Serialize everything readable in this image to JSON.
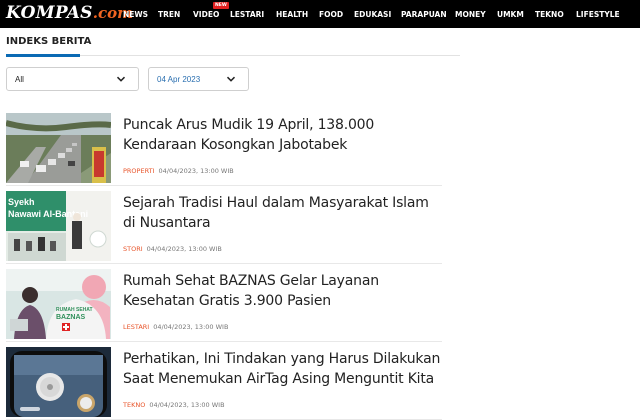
{
  "brand": {
    "name": "KOMPAS",
    "suffix": ".com"
  },
  "nav": {
    "items": [
      {
        "label": "NEWS"
      },
      {
        "label": "TREN"
      },
      {
        "label": "VIDEO",
        "badge": "NEW"
      },
      {
        "label": "LESTARI"
      },
      {
        "label": "HEALTH"
      },
      {
        "label": "FOOD"
      },
      {
        "label": "EDUKASI"
      },
      {
        "label": "PARAPUAN"
      },
      {
        "label": "MONEY"
      },
      {
        "label": "UMKM"
      },
      {
        "label": "TEKNO"
      },
      {
        "label": "LIFESTYLE"
      }
    ]
  },
  "page": {
    "title": "INDEKS BERITA"
  },
  "filters": {
    "category_value": "All",
    "date_value": "04 Apr 2023"
  },
  "articles": [
    {
      "title": "Puncak Arus Mudik 19 April, 138.000 Kendaraan Kosongkan Jabotabek",
      "category": "PROPERTI",
      "date": "04/04/2023, 13:00 WIB",
      "thumb": "highway"
    },
    {
      "title": "Sejarah Tradisi Haul dalam Masyarakat Islam di Nusantara",
      "category": "STORI",
      "date": "04/04/2023, 13:00 WIB",
      "thumb": "event",
      "thumb_text": [
        "Syekh",
        "Nawawi Al-Bantani"
      ]
    },
    {
      "title": "Rumah Sehat BAZNAS Gelar Layanan Kesehatan Gratis 3.900 Pasien",
      "category": "LESTARI",
      "date": "04/04/2023, 13:00 WIB",
      "thumb": "health",
      "thumb_text": [
        "RUMAH SEHAT",
        "BAZNAS"
      ]
    },
    {
      "title": "Perhatikan, Ini Tindakan yang Harus Dilakukan Saat Menemukan AirTag Asing Menguntit Kita",
      "category": "TEKNO",
      "date": "04/04/2023, 13:00 WIB",
      "thumb": "airtag"
    }
  ],
  "colors": {
    "topbar": "#000000",
    "accent": "#0a6ab4",
    "category": "#e8542a",
    "brand_dot": "#f26522"
  }
}
